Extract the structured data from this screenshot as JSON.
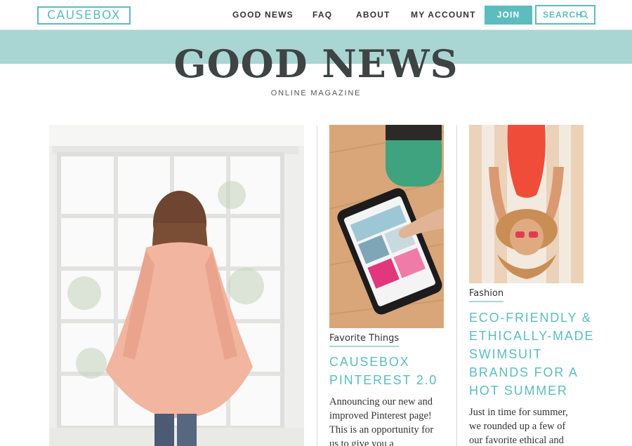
{
  "header": {
    "logo": "CAUSEBOX",
    "nav": [
      "GOOD NEWS",
      "FAQ",
      "ABOUT",
      "MY ACCOUNT"
    ],
    "join_label": "JOIN",
    "search_label": "SEARCH",
    "search_icon": "search-icon"
  },
  "hero": {
    "title": "GOOD NEWS",
    "subtitle": "ONLINE MAGAZINE"
  },
  "colors": {
    "accent": "#5cbcbf",
    "band": "#a9d5d2",
    "title": "#3e4444"
  },
  "posts": [
    {
      "image": "woman-in-peach-cardigan-at-window"
    },
    {
      "image": "phone-showing-pinterest",
      "category": "Favorite Things",
      "title_lines": [
        "CAUSEBOX",
        "PINTEREST 2.0"
      ],
      "excerpt_lines": [
        "Announcing our new and",
        "improved Pinterest page!",
        "This is an opportunity for",
        "us to give you a"
      ]
    },
    {
      "image": "woman-in-red-swimsuit-on-towel",
      "category": "Fashion",
      "title_lines": [
        "ECO-FRIENDLY &",
        "ETHICALLY-MADE",
        "SWIMSUIT",
        "BRANDS FOR A",
        "HOT SUMMER"
      ],
      "excerpt_lines": [
        "Just in time for summer,",
        "we rounded up a few of",
        "our favorite ethical and"
      ]
    }
  ]
}
